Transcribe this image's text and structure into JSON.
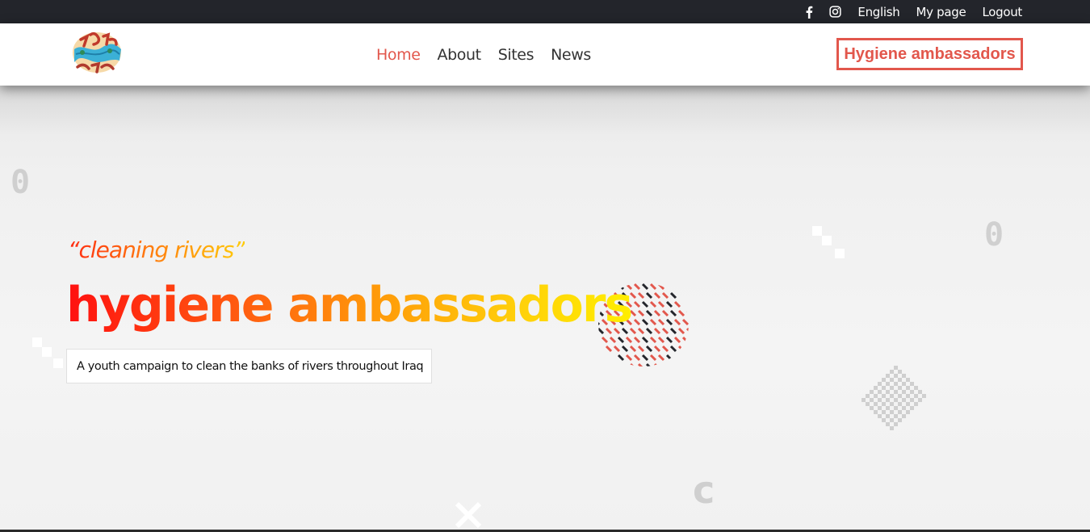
{
  "topbar": {
    "icons": [
      "facebook-icon",
      "instagram-icon"
    ],
    "language": "English",
    "my_page": "My page",
    "logout": "Logout"
  },
  "nav": {
    "logo_alt": "logo",
    "items": [
      {
        "label": "Home",
        "active": true
      },
      {
        "label": "About",
        "active": false
      },
      {
        "label": "Sites",
        "active": false
      },
      {
        "label": "News",
        "active": false
      }
    ],
    "brand_button": "Hygiene ambassadors"
  },
  "hero": {
    "tagline": "“cleaning rivers”",
    "headline": "hygiene ambassadors",
    "subtitle": "A youth campaign to clean the banks of rivers throughout Iraq",
    "deco_glyphs": [
      "0",
      "0",
      "c"
    ]
  },
  "colors": {
    "accent": "#e2574c",
    "topbar_bg": "#23252b",
    "gradient_start": "#ff1010",
    "gradient_end": "#ffee00"
  }
}
